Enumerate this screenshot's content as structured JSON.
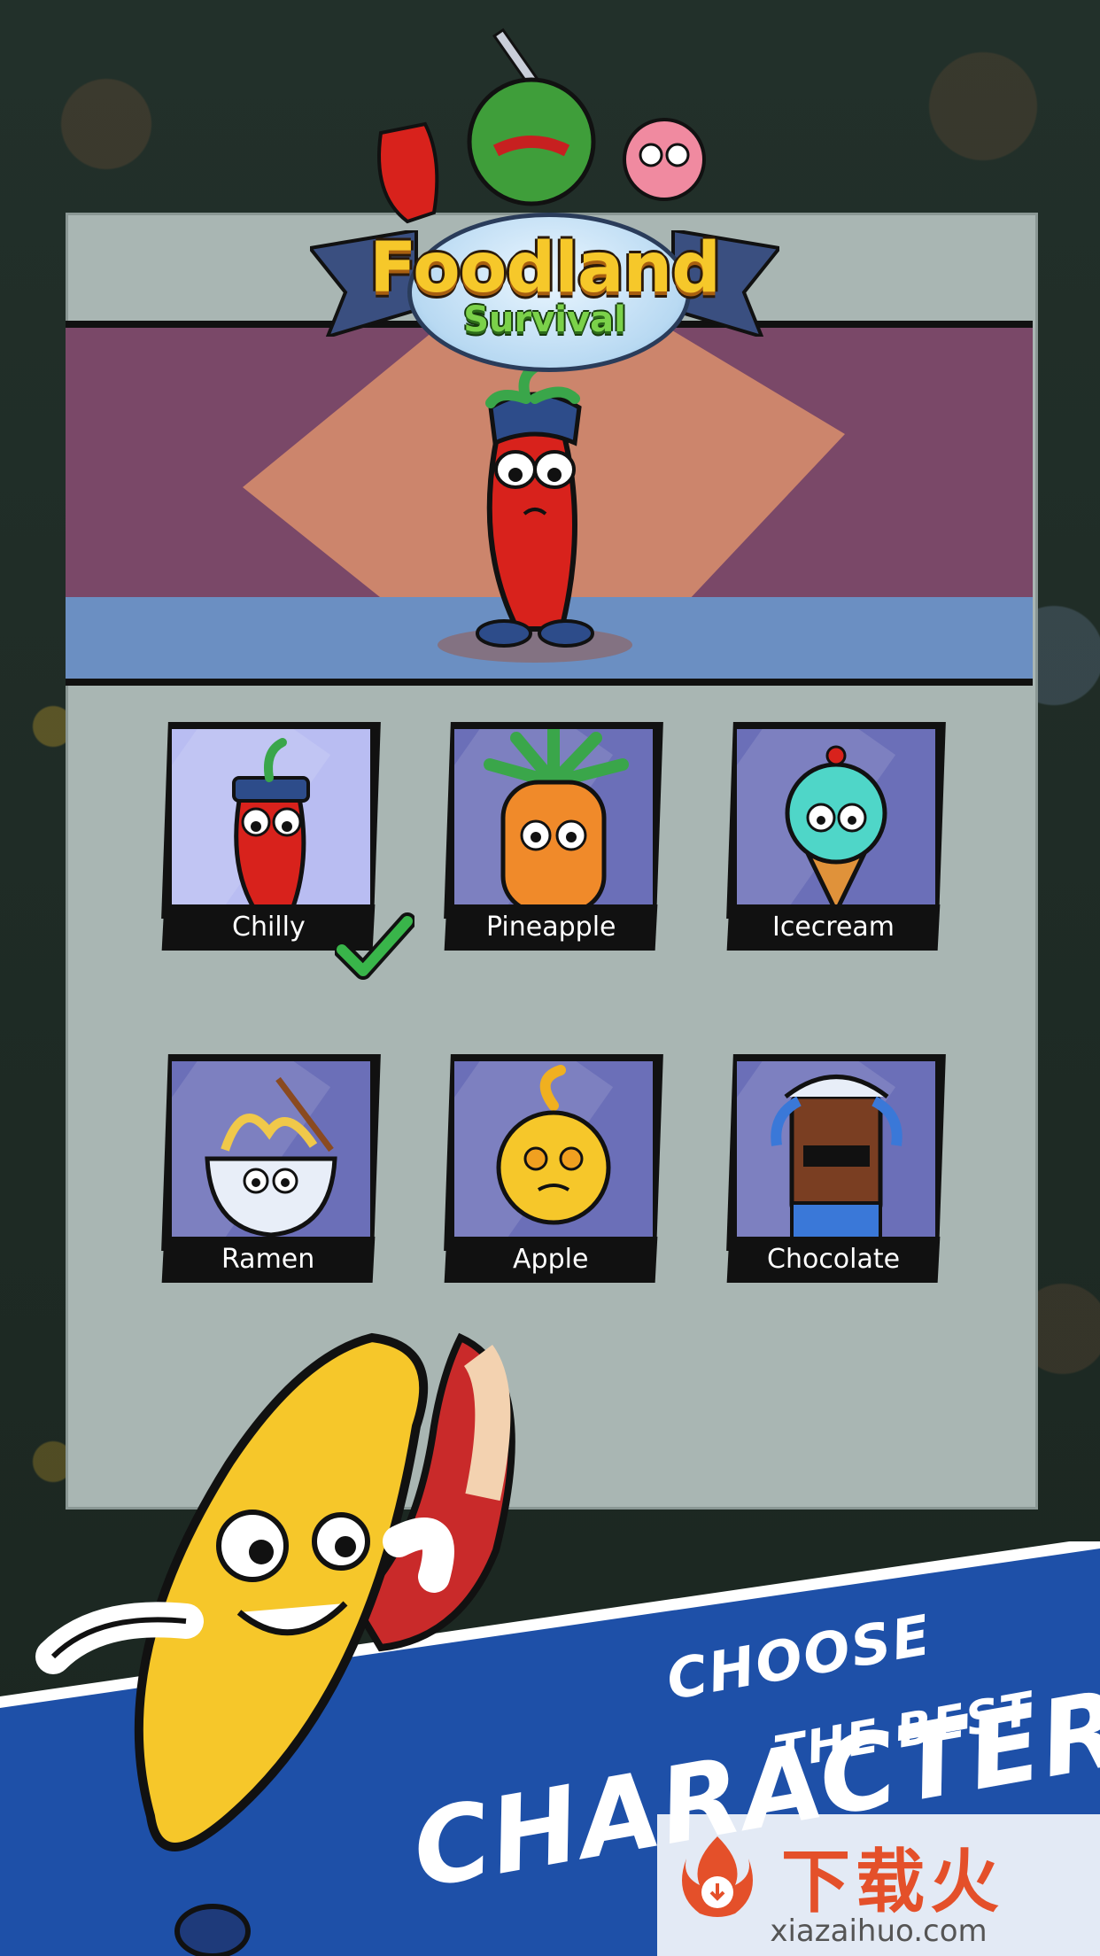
{
  "logo": {
    "title": "Foodland",
    "subtitle": "Survival"
  },
  "featured_character": "Chilly",
  "characters": [
    {
      "name": "Chilly",
      "selected": true
    },
    {
      "name": "Pineapple",
      "selected": false
    },
    {
      "name": "Icecream",
      "selected": false
    },
    {
      "name": "Ramen",
      "selected": false
    },
    {
      "name": "Apple",
      "selected": false
    },
    {
      "name": "Chocolate",
      "selected": false
    }
  ],
  "tagline": {
    "line1": "CHOOSE",
    "line2": "THE BEST",
    "line3": "CHARACTER"
  },
  "watermark": {
    "brand": "下载火",
    "url": "xiazaihuo.com"
  },
  "colors": {
    "banner": "#1e50a8",
    "panel": "#a9b6b3",
    "card_bg": "#6b6fb8",
    "check": "#39b54a"
  }
}
